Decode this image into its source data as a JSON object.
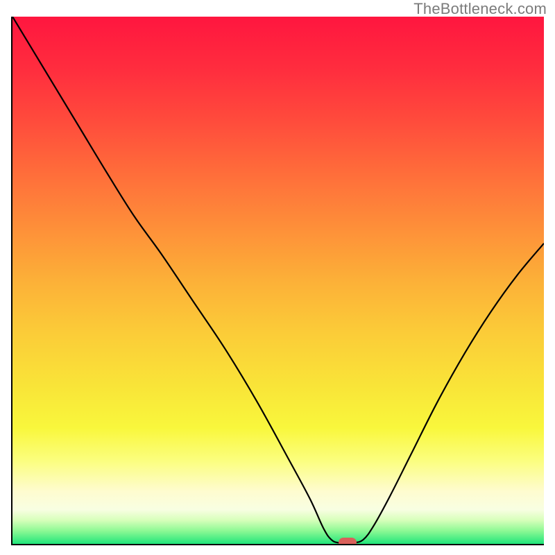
{
  "attribution": "TheBottleneck.com",
  "chart_data": {
    "type": "line",
    "title": "",
    "xlabel": "",
    "ylabel": "",
    "xlim": [
      0,
      100
    ],
    "ylim": [
      0,
      100
    ],
    "gradient_stops": [
      {
        "pos": 0.0,
        "color": "#ff163f"
      },
      {
        "pos": 0.1,
        "color": "#ff2d3e"
      },
      {
        "pos": 0.2,
        "color": "#ff4c3c"
      },
      {
        "pos": 0.3,
        "color": "#ff6e3a"
      },
      {
        "pos": 0.4,
        "color": "#fe8f39"
      },
      {
        "pos": 0.5,
        "color": "#fcb038"
      },
      {
        "pos": 0.6,
        "color": "#fbcc38"
      },
      {
        "pos": 0.7,
        "color": "#f9e438"
      },
      {
        "pos": 0.78,
        "color": "#f9f73c"
      },
      {
        "pos": 0.84,
        "color": "#fbfe7c"
      },
      {
        "pos": 0.9,
        "color": "#fefccf"
      },
      {
        "pos": 0.935,
        "color": "#f8fee2"
      },
      {
        "pos": 0.955,
        "color": "#d7ffba"
      },
      {
        "pos": 0.975,
        "color": "#8ef995"
      },
      {
        "pos": 1.0,
        "color": "#20e57a"
      }
    ],
    "series": [
      {
        "name": "curve",
        "points": [
          {
            "x": 0.0,
            "y": 100.0
          },
          {
            "x": 6.0,
            "y": 90.0
          },
          {
            "x": 12.0,
            "y": 80.0
          },
          {
            "x": 18.0,
            "y": 70.0
          },
          {
            "x": 23.0,
            "y": 62.0
          },
          {
            "x": 28.0,
            "y": 55.0
          },
          {
            "x": 34.0,
            "y": 46.0
          },
          {
            "x": 40.0,
            "y": 37.0
          },
          {
            "x": 46.0,
            "y": 27.0
          },
          {
            "x": 52.0,
            "y": 16.0
          },
          {
            "x": 56.0,
            "y": 8.5
          },
          {
            "x": 58.5,
            "y": 3.0
          },
          {
            "x": 60.0,
            "y": 0.8
          },
          {
            "x": 61.5,
            "y": 0.2
          },
          {
            "x": 64.0,
            "y": 0.2
          },
          {
            "x": 66.0,
            "y": 0.8
          },
          {
            "x": 68.0,
            "y": 3.5
          },
          {
            "x": 71.0,
            "y": 9.0
          },
          {
            "x": 75.0,
            "y": 17.0
          },
          {
            "x": 80.0,
            "y": 27.0
          },
          {
            "x": 85.0,
            "y": 36.0
          },
          {
            "x": 90.0,
            "y": 44.0
          },
          {
            "x": 95.0,
            "y": 51.0
          },
          {
            "x": 100.0,
            "y": 57.0
          }
        ]
      }
    ],
    "marker": {
      "x": 63.0,
      "y": 0.2,
      "color": "#d9605a"
    }
  }
}
